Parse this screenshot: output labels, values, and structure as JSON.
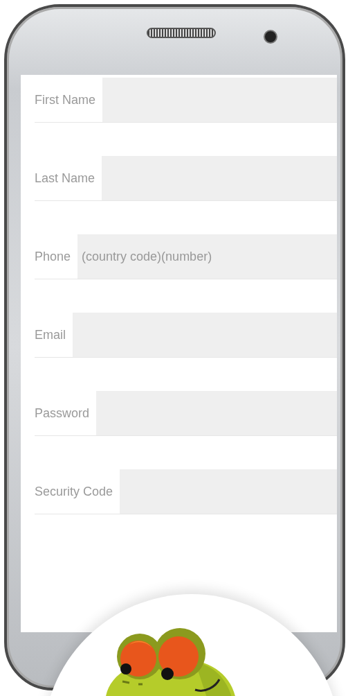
{
  "form": {
    "fields": [
      {
        "label": "First Name"
      },
      {
        "label": "Last Name"
      },
      {
        "label": "Phone",
        "placeholder": "(country code)(number)"
      },
      {
        "label": "Email"
      },
      {
        "label": "Password"
      },
      {
        "label": "Security Code"
      }
    ]
  }
}
